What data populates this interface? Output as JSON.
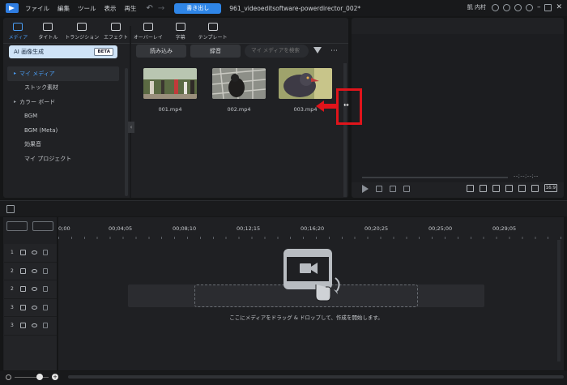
{
  "titlebar": {
    "menu": [
      "ファイル",
      "編集",
      "ツール",
      "表示",
      "再生"
    ],
    "export_label": "書き出し",
    "doc_title": "961_videoeditsoftware-powerdirector_002*",
    "user_name": "凱 内村"
  },
  "tabs": [
    {
      "label": "メディア",
      "icon": "media-icon"
    },
    {
      "label": "タイトル",
      "icon": "title-icon"
    },
    {
      "label": "トランジション",
      "icon": "transition-icon"
    },
    {
      "label": "エフェクト",
      "icon": "effect-icon"
    },
    {
      "label": "オーバーレイ",
      "icon": "overlay-icon"
    },
    {
      "label": "字幕",
      "icon": "subtitle-icon"
    },
    {
      "label": "テンプレート",
      "icon": "template-icon"
    }
  ],
  "ai": {
    "label": "AI 画像生成",
    "badge": "BETA"
  },
  "sidebar": {
    "items": [
      {
        "label": "マイ メディア"
      },
      {
        "label": "ストック素材"
      },
      {
        "label": "カラー ボード"
      },
      {
        "label": "BGM"
      },
      {
        "label": "BGM (Meta)"
      },
      {
        "label": "効果音"
      },
      {
        "label": "マイ プロジェクト"
      }
    ]
  },
  "media_toolbar": {
    "import_label": "読み込み",
    "record_label": "録音",
    "search_placeholder": "マイ メディアを検索"
  },
  "media_items": [
    {
      "name": "001.mp4"
    },
    {
      "name": "002.mp4"
    },
    {
      "name": "003.mp4"
    }
  ],
  "preview": {
    "time": "--;--;--;--",
    "aspect": "16:9"
  },
  "timeline": {
    "ruler": [
      "0;00",
      "00;04;05",
      "00;08;10",
      "00;12;15",
      "00;16;20",
      "00;20;25",
      "00;25;00",
      "00;29;05"
    ],
    "tracks": [
      {
        "num": "1",
        "kind": "audio"
      },
      {
        "num": "2",
        "kind": "video"
      },
      {
        "num": "2",
        "kind": "audio"
      },
      {
        "num": "3",
        "kind": "video"
      },
      {
        "num": "3",
        "kind": "audio"
      }
    ],
    "drop_hint": "ここにメディアをドラッグ & ドロップして、作成を開始します。"
  },
  "colors": {
    "accent": "#2f86e8",
    "annotation": "#e0141b"
  }
}
